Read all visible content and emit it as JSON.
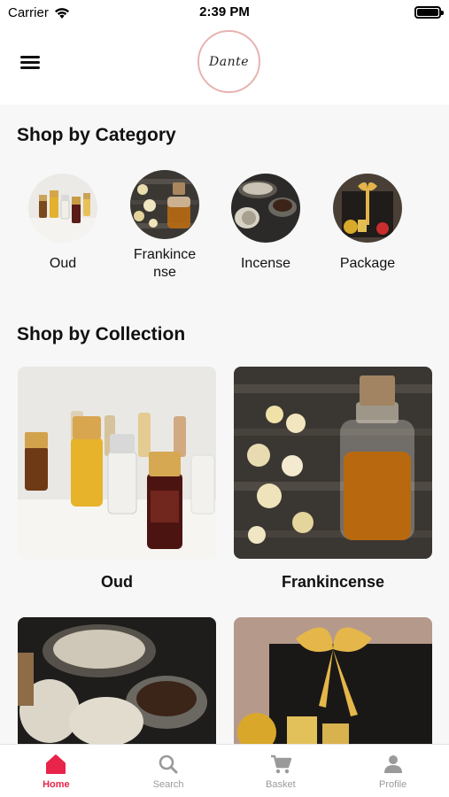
{
  "status_bar": {
    "carrier": "Carrier",
    "time": "2:39 PM"
  },
  "header": {
    "logo_text": "Dante"
  },
  "categories_section": {
    "title": "Shop by Category",
    "items": [
      {
        "label": "Oud",
        "icon": "oud-perfume-bottles"
      },
      {
        "label": "Frankince\nnse",
        "icon": "frankincense-oil-bottle"
      },
      {
        "label": "Incense",
        "icon": "incense-bowls"
      },
      {
        "label": "Package",
        "icon": "gift-package"
      }
    ]
  },
  "collections_section": {
    "title": "Shop by Collection",
    "items": [
      {
        "label": "Oud",
        "icon": "oud-perfume-bottles"
      },
      {
        "label": "Frankincense",
        "icon": "frankincense-oil-bottle"
      },
      {
        "label": "",
        "icon": "incense-bowls"
      },
      {
        "label": "",
        "icon": "gift-package"
      }
    ]
  },
  "tab_bar": {
    "tabs": [
      {
        "label": "Home",
        "icon": "home-icon",
        "active": true
      },
      {
        "label": "Search",
        "icon": "search-icon",
        "active": false
      },
      {
        "label": "Basket",
        "icon": "cart-icon",
        "active": false
      },
      {
        "label": "Profile",
        "icon": "person-icon",
        "active": false
      }
    ]
  },
  "colors": {
    "accent": "#e8244b",
    "inactive": "#9a9a9a",
    "background": "#f7f7f7"
  }
}
